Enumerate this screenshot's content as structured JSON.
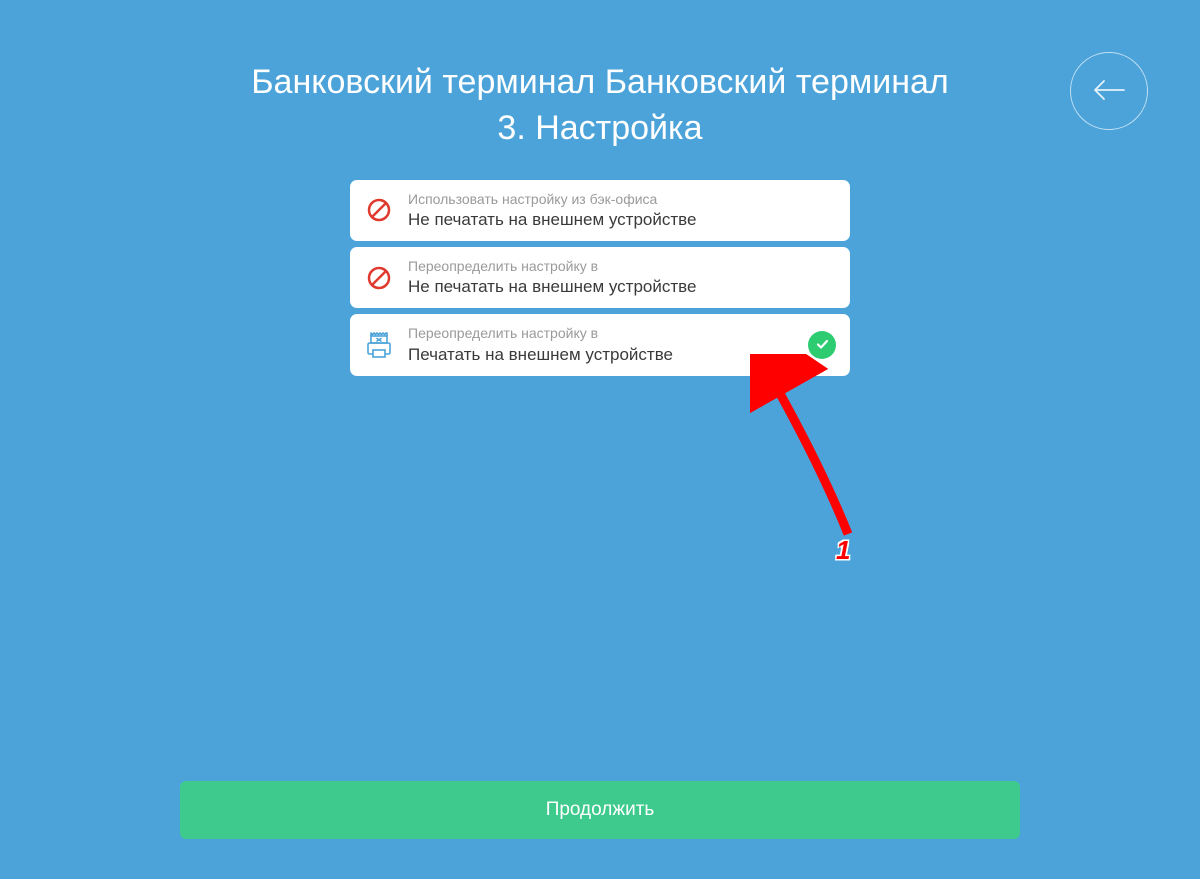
{
  "header": {
    "title": "Банковский терминал Банковский терминал 3. Настройка"
  },
  "options": [
    {
      "subtitle": "Использовать настройку из бэк-офиса",
      "label": "Не печатать на внешнем устройстве",
      "icon": "prohibit",
      "selected": false
    },
    {
      "subtitle": "Переопределить настройку в",
      "label": "Не печатать на внешнем устройстве",
      "icon": "prohibit",
      "selected": false
    },
    {
      "subtitle": "Переопределить настройку в",
      "label": "Печатать на внешнем устройстве",
      "icon": "printer",
      "selected": true
    }
  ],
  "footer": {
    "continue_label": "Продолжить"
  },
  "annotation": {
    "number": "1"
  }
}
